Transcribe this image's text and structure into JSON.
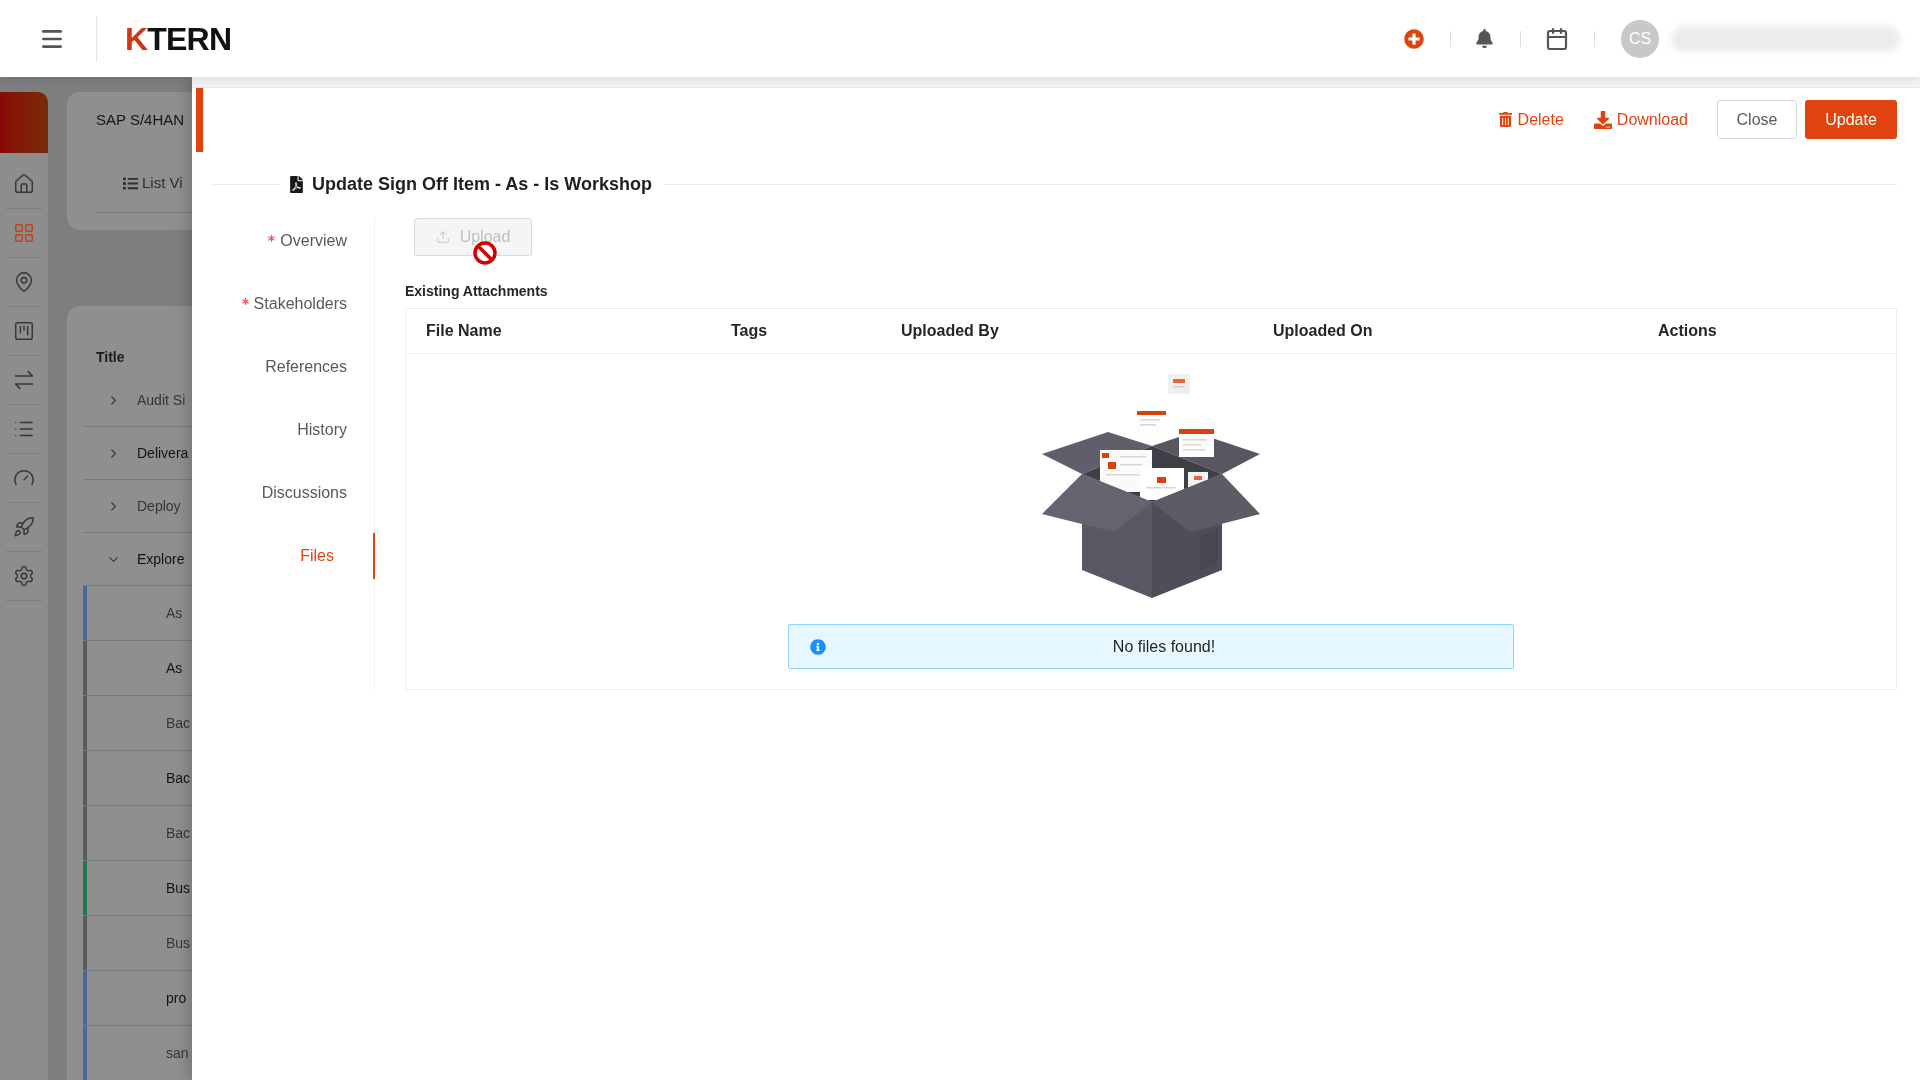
{
  "top_bar": {
    "logo": {
      "mark": "K",
      "text": "TERN"
    },
    "avatar_initials": "CS"
  },
  "background_page": {
    "rail": [
      {
        "selected": false
      },
      {
        "selected": true
      },
      {
        "selected": false
      },
      {
        "selected": false
      },
      {
        "selected": false
      },
      {
        "selected": false
      },
      {
        "selected": false
      },
      {
        "selected": false
      },
      {
        "selected": false
      }
    ],
    "project_card": {
      "title": "SAP S/4HAN",
      "view_toggle": "List Vi"
    },
    "tree": {
      "column": "Title",
      "items": [
        {
          "label": "Audit Si",
          "expanded": false
        },
        {
          "label": "Delivera",
          "expanded": false
        },
        {
          "label": "Deploy",
          "expanded": false
        },
        {
          "label": "Explore",
          "expanded": true,
          "children": [
            {
              "label": "As",
              "color": "#46699a"
            },
            {
              "label": "As",
              "color": "#585c60"
            },
            {
              "label": "Bac",
              "color": "#585c60"
            },
            {
              "label": "Bac",
              "color": "#585c60"
            },
            {
              "label": "Bac",
              "color": "#585c60"
            },
            {
              "label": "Bus",
              "color": "#1b7a50"
            },
            {
              "label": "Bus",
              "color": "#585c60"
            },
            {
              "label": "pro",
              "color": "#46699a"
            },
            {
              "label": "san",
              "color": "#46699a"
            }
          ]
        }
      ]
    }
  },
  "drawer": {
    "actions": [
      {
        "kind": "link",
        "label": "Delete"
      },
      {
        "kind": "link",
        "label": "Download"
      },
      {
        "kind": "outline",
        "label": "Close"
      },
      {
        "kind": "primary",
        "label": "Update"
      }
    ],
    "title": "Update Sign Off Item - As - Is Workshop",
    "sections": [
      {
        "label": "Overview",
        "required": true,
        "selected": false
      },
      {
        "label": "Stakeholders",
        "required": true,
        "selected": false
      },
      {
        "label": "References",
        "required": false,
        "selected": false
      },
      {
        "label": "History",
        "required": false,
        "selected": false
      },
      {
        "label": "Discussions",
        "required": false,
        "selected": false
      },
      {
        "label": "Files",
        "required": false,
        "selected": true
      }
    ],
    "upload": {
      "label": "Upload",
      "disabled": true
    },
    "attachments": {
      "heading": "Existing Attachments",
      "columns": [
        "File Name",
        "Tags",
        "Uploaded By",
        "Uploaded On",
        "Actions"
      ],
      "empty_message": "No files found!"
    }
  }
}
